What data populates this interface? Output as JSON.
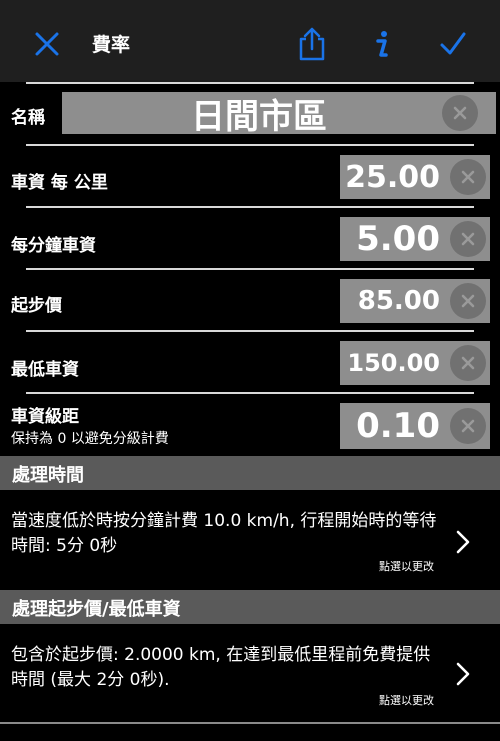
{
  "nav": {
    "title": "費率",
    "accent": "#1a73e8"
  },
  "name_row": {
    "label": "名稱",
    "value": "日間市區"
  },
  "rows": [
    {
      "label": "車資 每 公里",
      "value": "25.00"
    },
    {
      "label": "每分鐘車資",
      "value": "5.00"
    },
    {
      "label": "起步價",
      "value": "85.00"
    },
    {
      "label": "最低車資",
      "value": "150.00"
    },
    {
      "label": "車資級距",
      "sublabel": "保持為 0 以避免分級計費",
      "value": "0.10"
    }
  ],
  "sections": [
    {
      "title": "處理時間",
      "description": "當速度低於時按分鐘計費 10.0 km/h, 行程開始時的等待時間: 5分 0秒",
      "hint": "點選以更改"
    },
    {
      "title": "處理起步價/最低車資",
      "description": "包含於起步價: 2.0000 km, 在達到最低里程前免費提供時間 (最大 2分 0秒).",
      "hint": "點選以更改"
    }
  ]
}
